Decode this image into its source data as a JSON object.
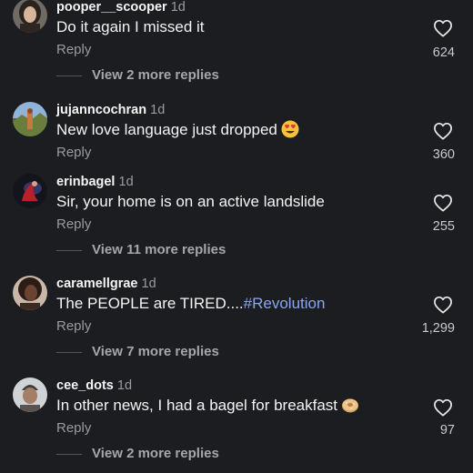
{
  "comments": [
    {
      "username": "pooper__scooper",
      "time": "1d",
      "text": "Do it again I missed it",
      "reply_label": "Reply",
      "likes": "624",
      "view_more": "View 2 more replies",
      "avatar_icon": "avatar-woman-dark-hair",
      "avatar_colors": [
        "#6f6a63",
        "#3a2f2a",
        "#d7b49a"
      ]
    },
    {
      "username": "jujanncochran",
      "time": "1d",
      "text": "New love language just dropped",
      "emoji": "heart-eyes-emoji",
      "reply_label": "Reply",
      "likes": "360",
      "avatar_icon": "avatar-landscape-sunset",
      "avatar_colors": [
        "#8fb3d9",
        "#c47a3f",
        "#4d6a36"
      ]
    },
    {
      "username": "erinbagel",
      "time": "1d",
      "text": "Sir, your home is on an active landslide",
      "reply_label": "Reply",
      "likes": "255",
      "view_more": "View 11 more replies",
      "avatar_icon": "avatar-red-figure-dark",
      "avatar_colors": [
        "#14151c",
        "#b8202a",
        "#3b3f7a"
      ]
    },
    {
      "username": "caramellgrae",
      "time": "1d",
      "text_plain": "The PEOPLE are TIRED....",
      "hashtag": "#Revolution",
      "reply_label": "Reply",
      "likes": "1,299",
      "view_more": "View 7 more replies",
      "avatar_icon": "avatar-woman-curly-hair",
      "avatar_colors": [
        "#c9b8a8",
        "#2a1c16",
        "#6b4330"
      ]
    },
    {
      "username": "cee_dots",
      "time": "1d",
      "text": "In other news, I had a bagel for breakfast",
      "emoji": "bagel-emoji",
      "reply_label": "Reply",
      "likes": "97",
      "view_more": "View 2 more replies",
      "avatar_icon": "avatar-man-beanie",
      "avatar_colors": [
        "#cfd3d6",
        "#3d3b3a",
        "#a47e66"
      ]
    }
  ],
  "colors": {
    "background": "#1c1d21",
    "primary_text": "#f4f4f4",
    "secondary_text": "#9a9ba0",
    "hashtag": "#8aa5f2"
  }
}
